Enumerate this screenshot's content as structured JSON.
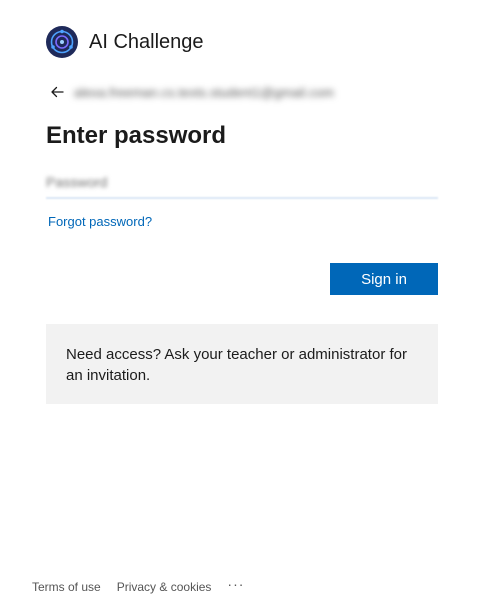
{
  "brand": {
    "name": "AI Challenge",
    "logo_icon": "ai-challenge-logo-icon",
    "colors": {
      "logo_bg": "#1f2a5a",
      "logo_ring": "#4ea3ff"
    }
  },
  "identity": {
    "back_icon": "arrow-left-icon",
    "email": "alexa.freeman.cs.texts.student1@gmail.com"
  },
  "title": "Enter password",
  "password": {
    "placeholder": "Password",
    "value": ""
  },
  "links": {
    "forgot_password": "Forgot password?"
  },
  "buttons": {
    "sign_in": "Sign in"
  },
  "info": {
    "text": "Need access? Ask your teacher or administrator for an invitation."
  },
  "footer": {
    "terms": "Terms of use",
    "privacy": "Privacy & cookies",
    "more": "···"
  },
  "colors": {
    "accent": "#0067b8",
    "info_bg": "#f2f2f2",
    "text": "#1b1b1b"
  }
}
